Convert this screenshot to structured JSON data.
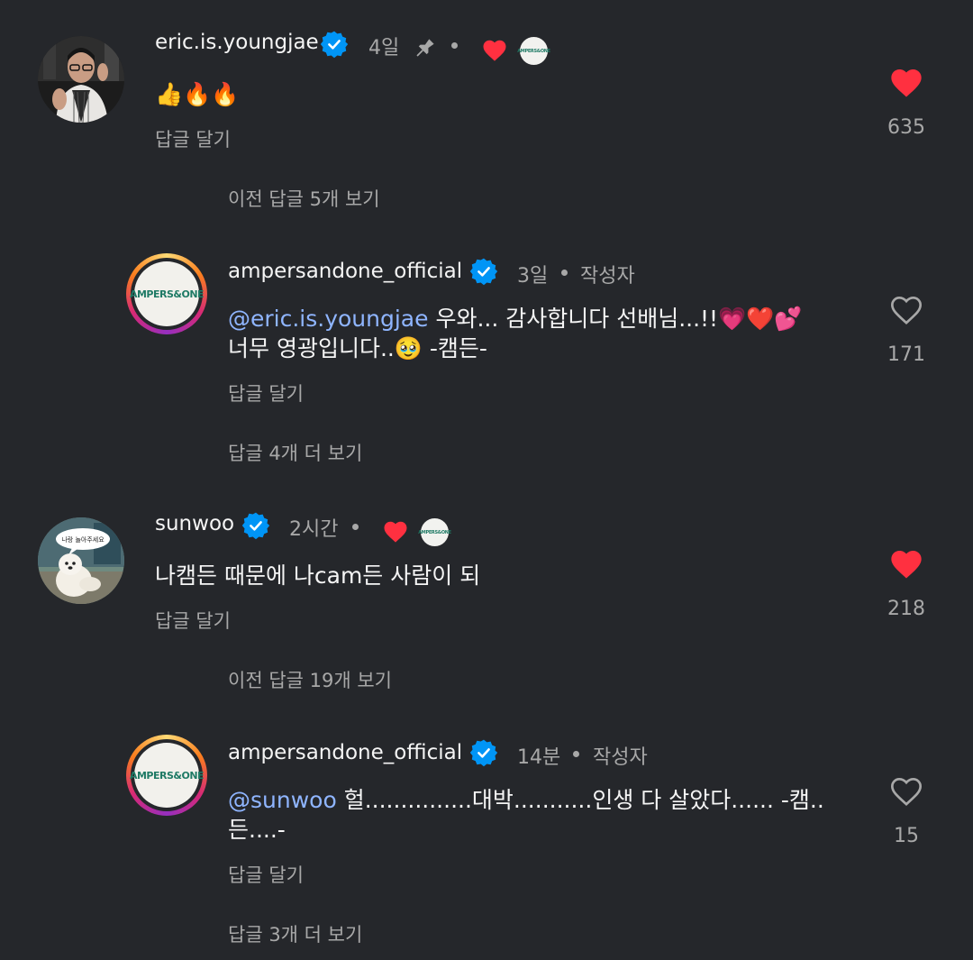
{
  "colors": {
    "background": "#25272b",
    "text": "#f5f5f5",
    "muted": "#a8a8a8",
    "mention": "#8fb5ff",
    "like_red": "#ff3040",
    "verified_blue": "#0095f6",
    "brand_green": "#1f7a65"
  },
  "comments": [
    {
      "username": "eric.is.youngjae",
      "time": "4일",
      "pinned_icon": "pin-icon",
      "text": "👍🔥🔥",
      "reply_label": "답글 달기",
      "likes": "635",
      "liked": true,
      "creator_liked": true,
      "view_replies": "이전 답글 5개 보기"
    },
    {
      "username": "ampersandone_official",
      "time": "3일",
      "author_label": "작성자",
      "mention": "@eric.is.youngjae",
      "text_line1": " 우와... 감사합니다 선배님...!!💗❤️💕",
      "text_line2": "너무 영광입니다..🥹 -캠든-",
      "reply_label": "답글 달기",
      "likes": "171",
      "liked": false,
      "view_more": "답글 4개 더 보기"
    },
    {
      "username": "sunwoo",
      "time": "2시간",
      "text": "나캠든 때문에 나cam든 사람이 되",
      "reply_label": "답글 달기",
      "likes": "218",
      "liked": true,
      "creator_liked": true,
      "avatar_speech": "나랑 놀아주세요",
      "view_replies": "이전 답글 19개 보기"
    },
    {
      "username": "ampersandone_official",
      "time": "14분",
      "author_label": "작성자",
      "mention": "@sunwoo",
      "text_line1": " 헐...............대박...........인생 다 살았다...... -캠..",
      "text_line2": "든....-",
      "reply_label": "답글 달기",
      "likes": "15",
      "liked": false,
      "view_more": "답글 3개 더 보기"
    }
  ],
  "brand_logo_text": "AMPERS&ONE"
}
